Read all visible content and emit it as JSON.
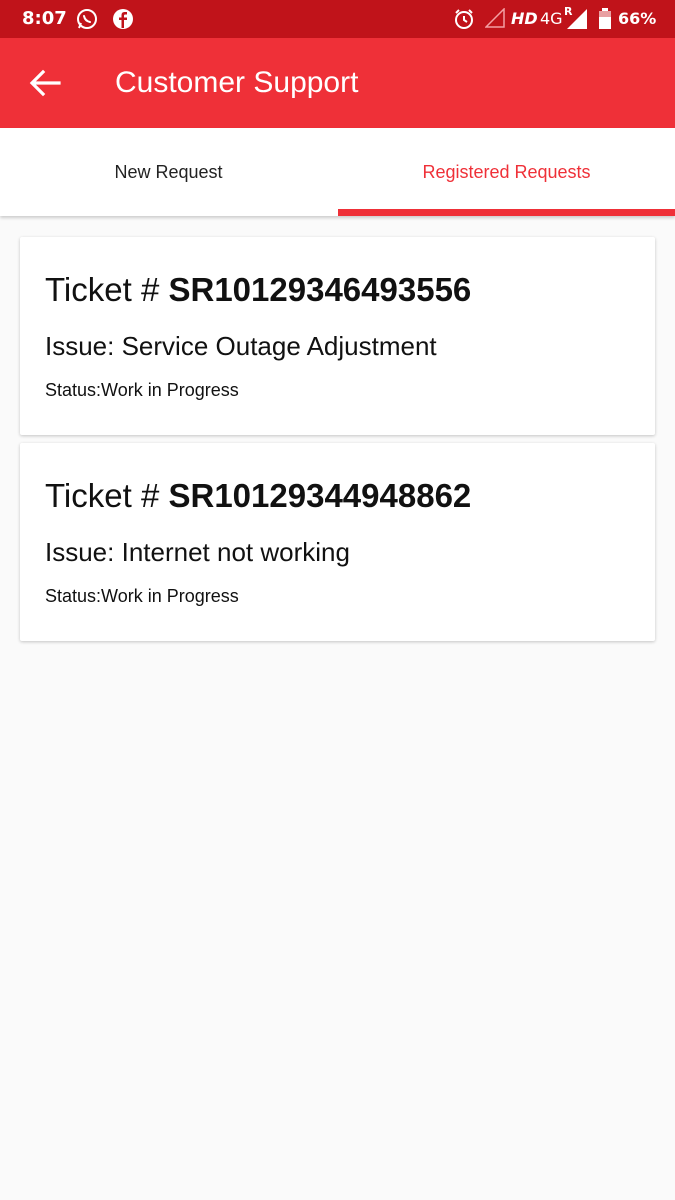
{
  "status_bar": {
    "time": "8:07",
    "network": "HD",
    "network_type": "4G",
    "roaming": "R",
    "battery": "66%",
    "left_icons": [
      "whatsapp-icon",
      "facebook-icon"
    ],
    "right_icons": [
      "alarm-icon",
      "signal-empty-icon",
      "signal-icon",
      "battery-icon"
    ]
  },
  "app_bar": {
    "title": "Customer Support",
    "back_icon": "arrow-left-icon"
  },
  "tabs": [
    {
      "label": "New Request",
      "active": false
    },
    {
      "label": "Registered Requests",
      "active": true
    }
  ],
  "tickets": [
    {
      "ticket_prefix": "Ticket # ",
      "ticket_id": "SR10129346493556",
      "issue": "Issue: Service Outage Adjustment",
      "status": "Status:Work in Progress"
    },
    {
      "ticket_prefix": "Ticket # ",
      "ticket_id": "SR10129344948862",
      "issue": "Issue: Internet not working",
      "status": "Status:Work in Progress"
    }
  ],
  "colors": {
    "status_bar": "#c0131a",
    "primary": "#ef3038",
    "background": "#fafafa",
    "card": "#ffffff"
  }
}
